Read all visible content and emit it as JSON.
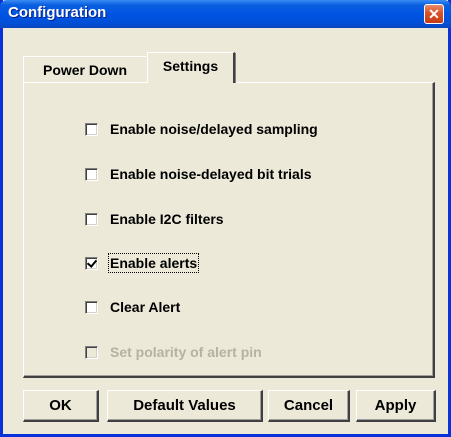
{
  "window": {
    "title": "Configuration"
  },
  "tabs": [
    {
      "label": "Power Down",
      "active": false
    },
    {
      "label": "Settings",
      "active": true
    }
  ],
  "options": [
    {
      "label": "Enable noise/delayed sampling",
      "checked": false,
      "enabled": true
    },
    {
      "label": "Enable noise-delayed bit trials",
      "checked": false,
      "enabled": true
    },
    {
      "label": "Enable I2C filters",
      "checked": false,
      "enabled": true
    },
    {
      "label": "Enable alerts",
      "checked": true,
      "enabled": true
    },
    {
      "label": "Clear Alert",
      "checked": false,
      "enabled": true
    },
    {
      "label": "Set polarity of alert pin",
      "checked": false,
      "enabled": false
    }
  ],
  "buttons": {
    "ok": "OK",
    "defaults": "Default Values",
    "cancel": "Cancel",
    "apply": "Apply"
  },
  "colors": {
    "titlebar": "#0054e3",
    "dialog_bg": "#ece9d8",
    "disabled_text": "#b5b2a2"
  }
}
